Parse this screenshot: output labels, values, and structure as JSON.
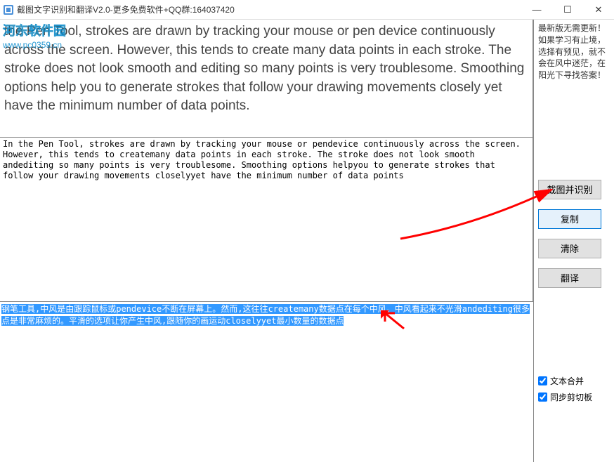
{
  "titlebar": {
    "title": "截图文字识别和翻译V2.0-更多免费软件+QQ群:164037420"
  },
  "window_controls": {
    "minimize": "—",
    "maximize": "☐",
    "close": "✕"
  },
  "watermark": {
    "line1": "河东软件园",
    "line2": "www.pc0359.cn"
  },
  "preview": {
    "text": "the Pen Tool, strokes are drawn by tracking your mouse or pen device continuously across the screen. However, this tends to create many data points in each stroke. The stroke does not look smooth and editing so many points is very troublesome. Smoothing options help you to generate strokes that follow your drawing movements closely yet have the minimum number of data points."
  },
  "ocr": {
    "text": "In the Pen Tool, strokes are drawn by tracking your mouse or pendevice continuously across the screen. However, this tends to createmany data points in each stroke. The stroke does not look smooth andediting so many points is very troublesome. Smoothing options helpyou to generate strokes that follow your drawing movements closelyyet have the minimum number of data points"
  },
  "translation": {
    "text": "钢笔工具,中风是由跟踪鼠标或pendevice不断在屏幕上。然而,这往往createmany数据点在每个中风。中风看起来不光滑andediting很多点是非常麻烦的。平滑的选项让你产生中风,跟随你的画运动closelyyet最小数量的数据点"
  },
  "sidebar": {
    "notice": "最新版无需更新！\n如果学习有止境，\n选择有预见，就不\n会在风中迷茫，在\n阳光下寻找答案！",
    "buttons": {
      "capture": "截图并识别",
      "copy": "复制",
      "clear": "清除",
      "translate": "翻译"
    },
    "checks": {
      "merge": "文本合并",
      "clipboard": "同步剪切板"
    }
  }
}
